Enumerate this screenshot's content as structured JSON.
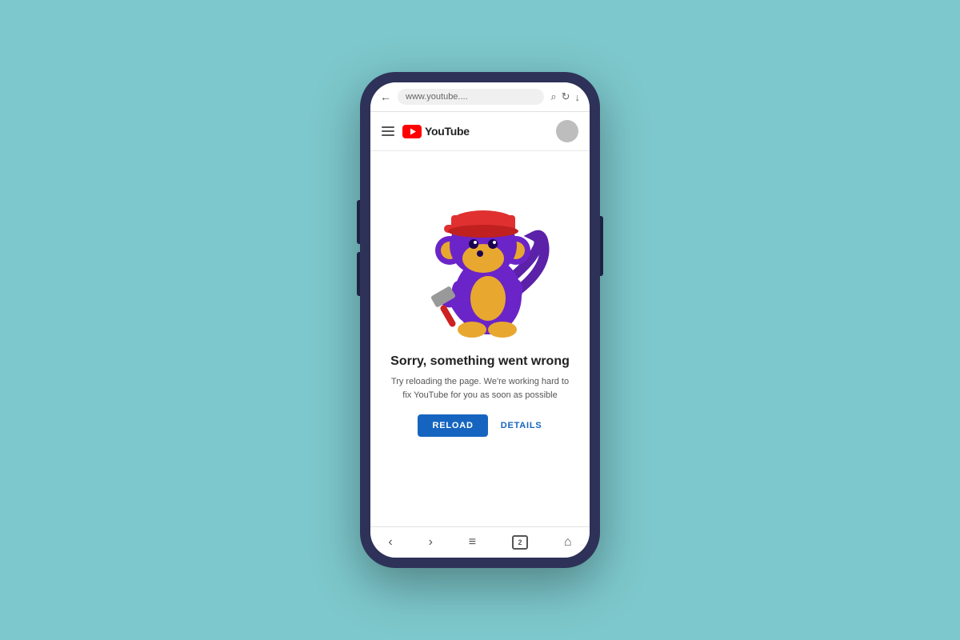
{
  "background": {
    "color": "#7dc8cc"
  },
  "phone": {
    "frame_color": "#2e3259"
  },
  "browser": {
    "address_text": "www.youtube....",
    "back_icon": "←",
    "search_icon": "⌕",
    "refresh_icon": "↻",
    "download_icon": "↓"
  },
  "youtube_header": {
    "logo_text": "YouTube",
    "hamburger_label": "menu"
  },
  "error_page": {
    "title": "Sorry, something went wrong",
    "subtitle": "Try reloading the page. We're working hard to fix YouTube for you as soon as possible",
    "reload_button": "RELOAD",
    "details_button": "DETAILS"
  },
  "nav_bar": {
    "back": "‹",
    "forward": "›",
    "menu": "≡",
    "tabs": "2",
    "home": "⌂"
  }
}
